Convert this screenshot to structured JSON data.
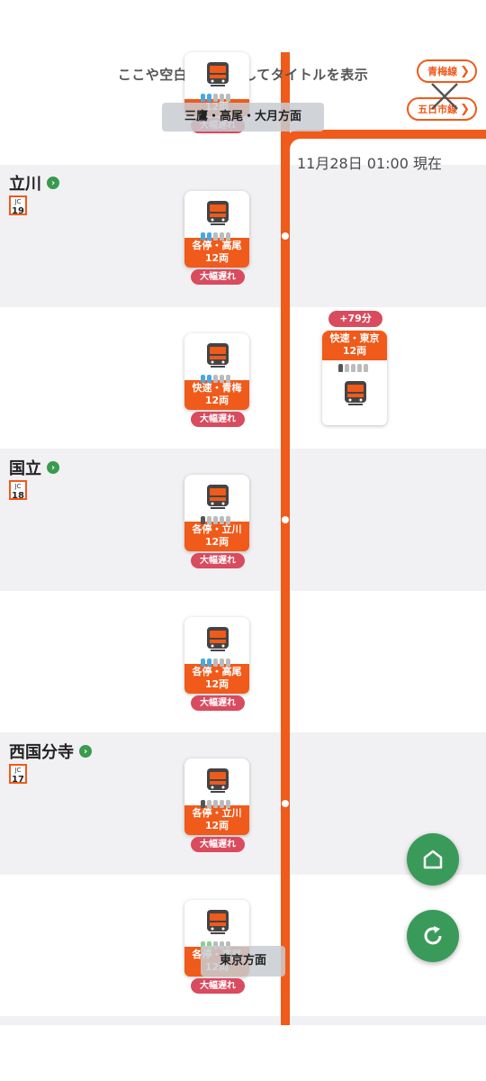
{
  "header": {
    "hint": "ここや空白をタップしてタイトルを表示",
    "direction_top": "三鷹・高尾・大月方面",
    "direction_bottom": "東京方面"
  },
  "lines": [
    {
      "label": "青梅線"
    },
    {
      "label": "五日市線"
    }
  ],
  "timestamp": "11月28日 01:00 現在",
  "stations": [
    {
      "name": "立川",
      "code_prefix": "JC",
      "code_num": "19"
    },
    {
      "name": "国立",
      "code_prefix": "JC",
      "code_num": "18"
    },
    {
      "name": "西国分寺",
      "code_prefix": "JC",
      "code_num": "17"
    }
  ],
  "trains_down": [
    {
      "type": "",
      "cars": "12両",
      "status": "大幅遅れ"
    },
    {
      "type": "各停・高尾",
      "cars": "12両",
      "status": "大幅遅れ"
    },
    {
      "type": "快速・青梅",
      "cars": "12両",
      "status": "大幅遅れ"
    },
    {
      "type": "各停・立川",
      "cars": "12両",
      "status": "大幅遅れ"
    },
    {
      "type": "各停・高尾",
      "cars": "12両",
      "status": "大幅遅れ"
    },
    {
      "type": "各停・立川",
      "cars": "12両",
      "status": "大幅遅れ"
    },
    {
      "type": "各停・高尾",
      "cars": "12両",
      "status": "大幅遅れ"
    }
  ],
  "train_up": {
    "delay": "+79分",
    "type": "快速・東京",
    "cars": "12両"
  },
  "colors": {
    "line_orange": "#f05a1a",
    "delay_red": "#d94b5e",
    "fab_green": "#3a9a5a",
    "band_gray": "#f1f1f4"
  },
  "icons": {
    "train": "train-front-icon",
    "home": "home-icon",
    "refresh": "refresh-icon",
    "close": "close-icon"
  }
}
